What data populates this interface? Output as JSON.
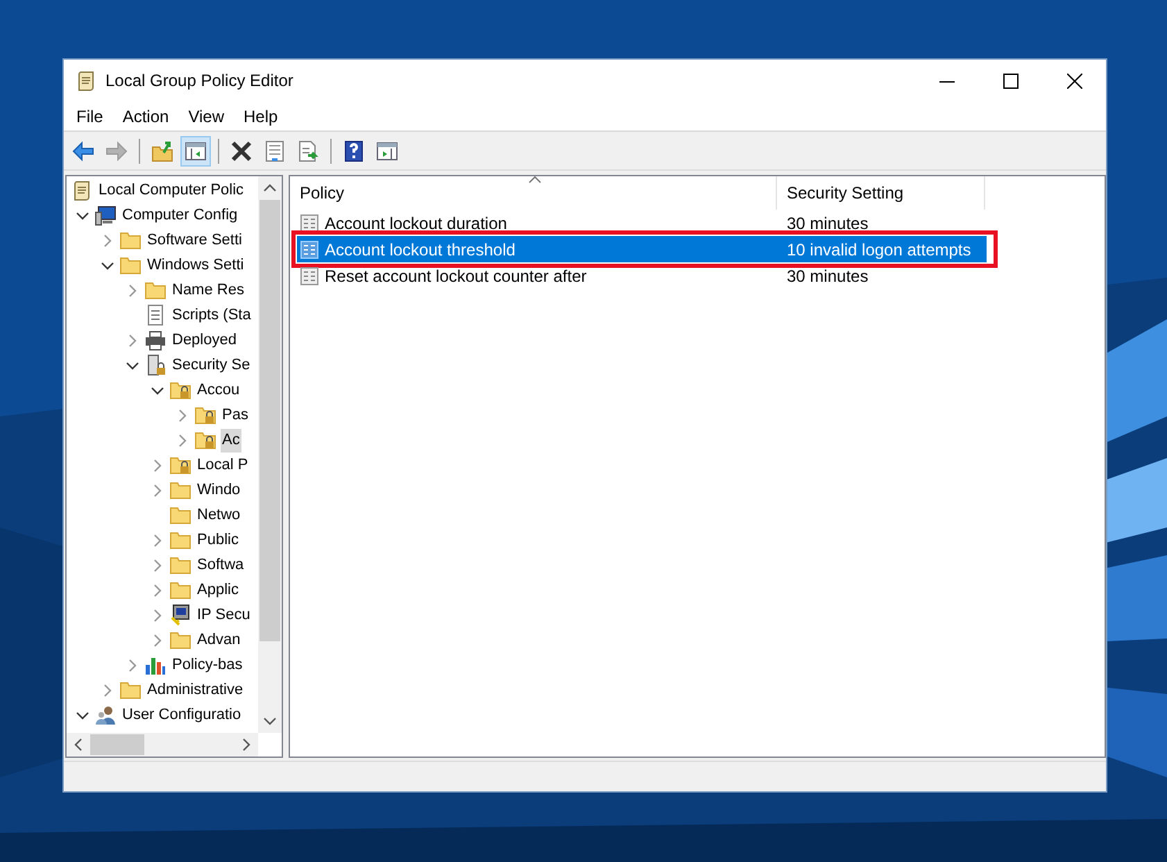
{
  "window": {
    "title": "Local Group Policy Editor"
  },
  "menu": [
    "File",
    "Action",
    "View",
    "Help"
  ],
  "toolbar": [
    {
      "kind": "back",
      "disabled": false,
      "pressed": false
    },
    {
      "kind": "forward",
      "disabled": true,
      "pressed": false
    },
    {
      "kind": "separator"
    },
    {
      "kind": "up",
      "disabled": false,
      "pressed": false
    },
    {
      "kind": "tree",
      "disabled": false,
      "pressed": true
    },
    {
      "kind": "separator"
    },
    {
      "kind": "delete",
      "disabled": false,
      "pressed": false
    },
    {
      "kind": "properties",
      "disabled": false,
      "pressed": false
    },
    {
      "kind": "export",
      "disabled": false,
      "pressed": false
    },
    {
      "kind": "separator"
    },
    {
      "kind": "help",
      "disabled": false,
      "pressed": false
    },
    {
      "kind": "actionpane",
      "disabled": false,
      "pressed": false
    }
  ],
  "tree": [
    {
      "label": "Local Computer Polic",
      "kind": "scroll",
      "selected": false,
      "children": [
        {
          "label": "Computer Config",
          "kind": "computer",
          "expanded": true,
          "selected": false,
          "children": [
            {
              "label": "Software Setti",
              "kind": "folder",
              "expanded": false,
              "selected": false
            },
            {
              "label": "Windows Setti",
              "kind": "folder",
              "expanded": true,
              "selected": false,
              "children": [
                {
                  "label": "Name Res",
                  "kind": "folder",
                  "expanded": false,
                  "selected": false
                },
                {
                  "label": "Scripts (Sta",
                  "kind": "script",
                  "selected": false
                },
                {
                  "label": "Deployed",
                  "kind": "printer",
                  "expanded": false,
                  "selected": false
                },
                {
                  "label": "Security Se",
                  "kind": "server",
                  "expanded": true,
                  "selected": false,
                  "children": [
                    {
                      "label": "Accou",
                      "kind": "lockfolder",
                      "expanded": true,
                      "selected": false,
                      "children": [
                        {
                          "label": "Pas",
                          "kind": "lockfolder",
                          "expanded": false,
                          "selected": false
                        },
                        {
                          "label": "Ac",
                          "kind": "lockfolder",
                          "expanded": false,
                          "selected": true
                        }
                      ]
                    },
                    {
                      "label": "Local P",
                      "kind": "lockfolder",
                      "expanded": false,
                      "selected": false
                    },
                    {
                      "label": "Windo",
                      "kind": "folder",
                      "expanded": false,
                      "selected": false
                    },
                    {
                      "label": "Netwo",
                      "kind": "folder",
                      "selected": false
                    },
                    {
                      "label": "Public",
                      "kind": "folder",
                      "expanded": false,
                      "selected": false
                    },
                    {
                      "label": "Softwa",
                      "kind": "folder",
                      "expanded": false,
                      "selected": false
                    },
                    {
                      "label": "Applic",
                      "kind": "folder",
                      "expanded": false,
                      "selected": false
                    },
                    {
                      "label": "IP Secu",
                      "kind": "ipsec",
                      "expanded": false,
                      "selected": false
                    },
                    {
                      "label": "Advan",
                      "kind": "folder",
                      "expanded": false,
                      "selected": false
                    }
                  ]
                },
                {
                  "label": "Policy-bas",
                  "kind": "chart",
                  "expanded": false,
                  "selected": false
                }
              ]
            },
            {
              "label": "Administrative",
              "kind": "folder",
              "expanded": false,
              "selected": false
            }
          ]
        },
        {
          "label": "User Configuratio",
          "kind": "user",
          "expanded": true,
          "selected": false
        }
      ]
    }
  ],
  "list": {
    "columns": [
      "Policy",
      "Security Setting"
    ],
    "rows": [
      {
        "policy": "Account lockout duration",
        "setting": "30 minutes",
        "selected": false,
        "highlighted": false
      },
      {
        "policy": "Account lockout threshold",
        "setting": "10 invalid logon attempts",
        "selected": true,
        "highlighted": true
      },
      {
        "policy": "Reset account lockout counter after",
        "setting": "30 minutes",
        "selected": false,
        "highlighted": false
      }
    ]
  }
}
